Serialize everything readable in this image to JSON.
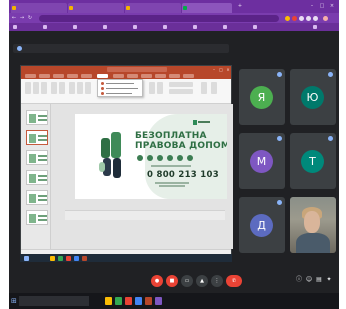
{
  "slide": {
    "headline_line1": "БЕЗОПЛАТНА",
    "headline_line2": "ПРАВОВА ДОПОМОГА",
    "phone": "0 800 213 103"
  },
  "participants": [
    {
      "initial": "Я",
      "color": "#4caf50"
    },
    {
      "initial": "Ю",
      "color": "#00796b"
    },
    {
      "initial": "М",
      "color": "#7e57c2"
    },
    {
      "initial": "Т",
      "color": "#00897b"
    },
    {
      "initial": "Д",
      "color": "#5c6bc0"
    }
  ],
  "colors": {
    "browser_chrome": "#6d2fa0",
    "meet_background": "#202124",
    "tile_background": "#3c4043",
    "leave_call": "#ea4335",
    "ppt_accent": "#b7472a",
    "slide_green": "#2f6f44"
  },
  "icons": {
    "host_taskbar_start": "windows-logo-icon",
    "controls": [
      "mic-icon",
      "camera-icon",
      "captions-icon",
      "present-icon",
      "more-icon",
      "leave-call-icon"
    ]
  }
}
